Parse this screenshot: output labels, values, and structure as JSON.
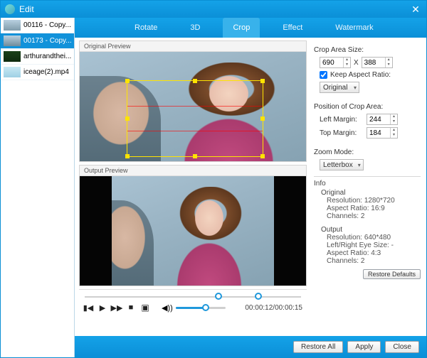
{
  "window": {
    "title": "Edit"
  },
  "sidebar": {
    "files": [
      {
        "name": "00116 - Copy..."
      },
      {
        "name": "00173 - Copy..."
      },
      {
        "name": "arthurandthei..."
      },
      {
        "name": "iceage(2).mp4"
      }
    ]
  },
  "tabs": {
    "rotate": "Rotate",
    "three_d": "3D",
    "crop": "Crop",
    "effect": "Effect",
    "watermark": "Watermark"
  },
  "preview": {
    "original_label": "Original Preview",
    "output_label": "Output Preview"
  },
  "crop": {
    "size_label": "Crop Area Size:",
    "width": "690",
    "x": "X",
    "height": "388",
    "keep_ratio_label": "Keep Aspect Ratio:",
    "keep_ratio_checked": true,
    "ratio_select": "Original",
    "position_label": "Position of Crop Area:",
    "left_margin_label": "Left Margin:",
    "left_margin": "244",
    "top_margin_label": "Top Margin:",
    "top_margin": "184",
    "zoom_label": "Zoom Mode:",
    "zoom_select": "Letterbox"
  },
  "info": {
    "header": "Info",
    "original_label": "Original",
    "original_resolution_label": "Resolution:",
    "original_resolution": "1280*720",
    "original_aspect_label": "Aspect Ratio:",
    "original_aspect": "16:9",
    "original_channels_label": "Channels:",
    "original_channels": "2",
    "output_label": "Output",
    "output_resolution_label": "Resolution:",
    "output_resolution": "640*480",
    "output_eye_label": "Left/Right Eye Size:",
    "output_eye": "-",
    "output_aspect_label": "Aspect Ratio:",
    "output_aspect": "4:3",
    "output_channels_label": "Channels:",
    "output_channels": "2"
  },
  "playbar": {
    "time": "00:00:12/00:00:15"
  },
  "buttons": {
    "restore_defaults": "Restore Defaults",
    "restore_all": "Restore All",
    "apply": "Apply",
    "close": "Close"
  }
}
